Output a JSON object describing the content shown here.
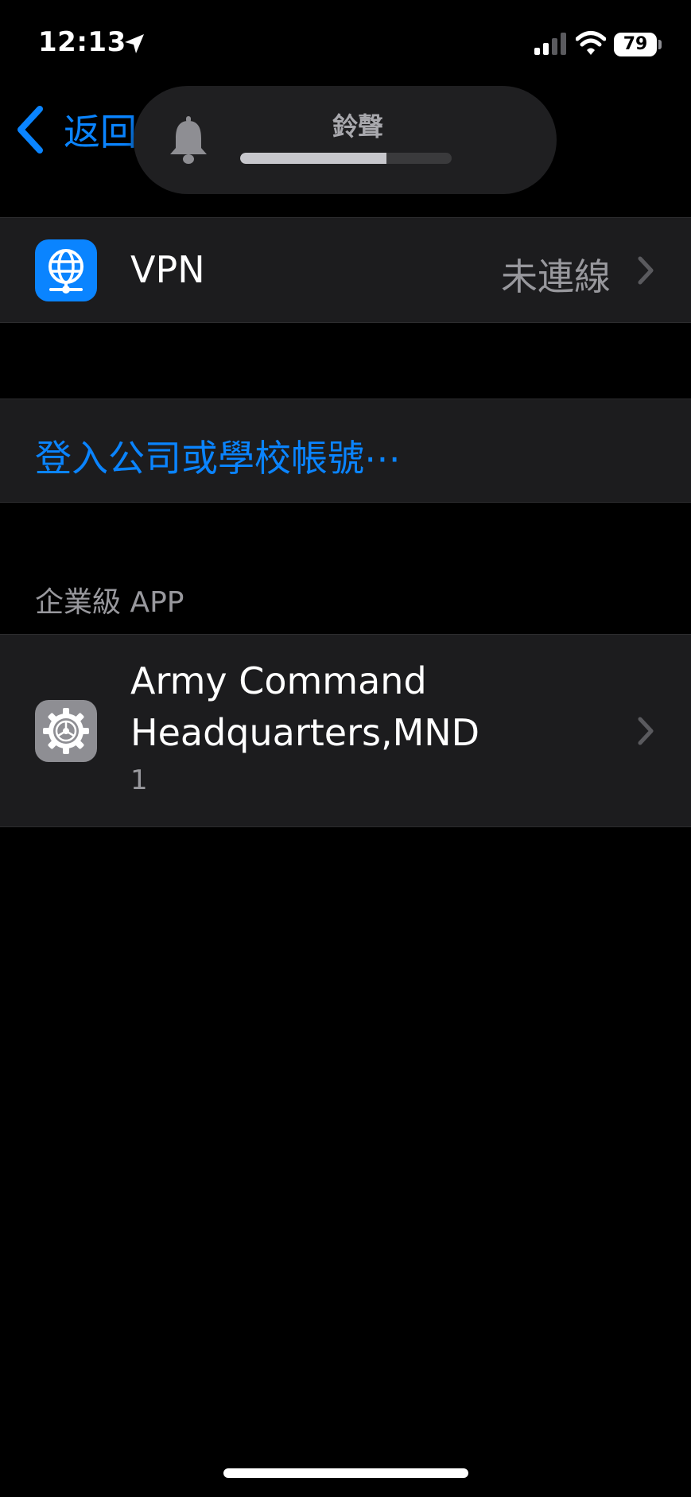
{
  "status_bar": {
    "time": "12:13",
    "battery_level": "79",
    "location_icon": "location-arrow-icon",
    "signal_icon": "cellular-signal-icon",
    "wifi_icon": "wifi-icon"
  },
  "nav": {
    "back_label": "返回",
    "back_icon": "chevron-left-icon"
  },
  "ringer_hud": {
    "label": "鈴聲",
    "level": 0.69,
    "icon": "bell-icon"
  },
  "vpn": {
    "title": "VPN",
    "status": "未連線",
    "icon": "vpn-globe-icon"
  },
  "signin": {
    "label": "登入公司或學校帳號⋯"
  },
  "enterprise": {
    "section_header": "企業級 APP",
    "items": [
      {
        "title_line1": "Army Command",
        "title_line2": "Headquarters,MND",
        "subtitle": "1",
        "icon": "gear-icon"
      }
    ]
  },
  "colors": {
    "accent": "#0a84ff",
    "background": "#000000",
    "cell_background": "#1c1c1e",
    "secondary_text": "#98989d"
  }
}
